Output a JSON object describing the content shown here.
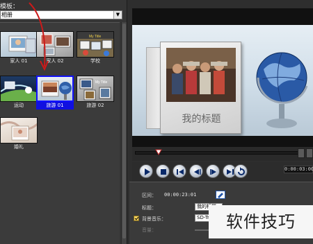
{
  "template_panel": {
    "header": "模板：",
    "category_selected": "相册",
    "templates": [
      {
        "name": "家人 01",
        "selected": false
      },
      {
        "name": "家人 02",
        "selected": false
      },
      {
        "name": "学校",
        "selected": false
      },
      {
        "name": "运动",
        "selected": false
      },
      {
        "name": "旅游 01",
        "selected": true
      },
      {
        "name": "旅游 02",
        "selected": false
      },
      {
        "name": "婚礼",
        "selected": false
      }
    ],
    "thumb_text": {
      "my_title": "My Title"
    }
  },
  "preview": {
    "frame_title": "我的标题"
  },
  "transport": {
    "buttons": [
      "play",
      "stop",
      "start",
      "previous-frame",
      "next-frame",
      "end",
      "repeat"
    ],
    "timecode": "0:00:03:00"
  },
  "properties": {
    "duration_label": "区间：",
    "duration_value": "00:00:23:01",
    "title_label": "标题：",
    "title_value": "我的标题",
    "bgm_label": "背景音乐：",
    "bgm_checked": true,
    "bgm_value": "SD-Travel",
    "volume_label": "音量："
  },
  "watermark": "软件技巧",
  "colors": {
    "selection_blue": "#1010e0",
    "annotation_red": "#cc1a1a",
    "panel_bg": "#353535"
  }
}
